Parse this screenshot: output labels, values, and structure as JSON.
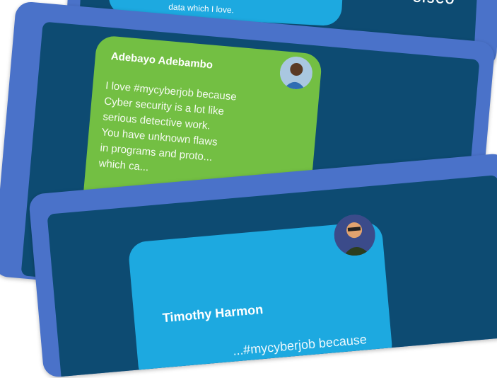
{
  "cards": {
    "top": {
      "snippet": "data which I love.",
      "logo": "CISCO"
    },
    "middle": {
      "name": "Adebayo Adebambo",
      "lines": [
        "I love #mycyberjob because",
        "Cyber security is a lot like",
        "serious detective work.",
        "You have unknown flaws",
        "in programs and proto...",
        "which ca..."
      ],
      "bubble_color": "#73bf43"
    },
    "bottom": {
      "name": "Timothy Harmon",
      "line": "...#mycyberjob because",
      "bubble_color": "#1da9e0"
    }
  }
}
